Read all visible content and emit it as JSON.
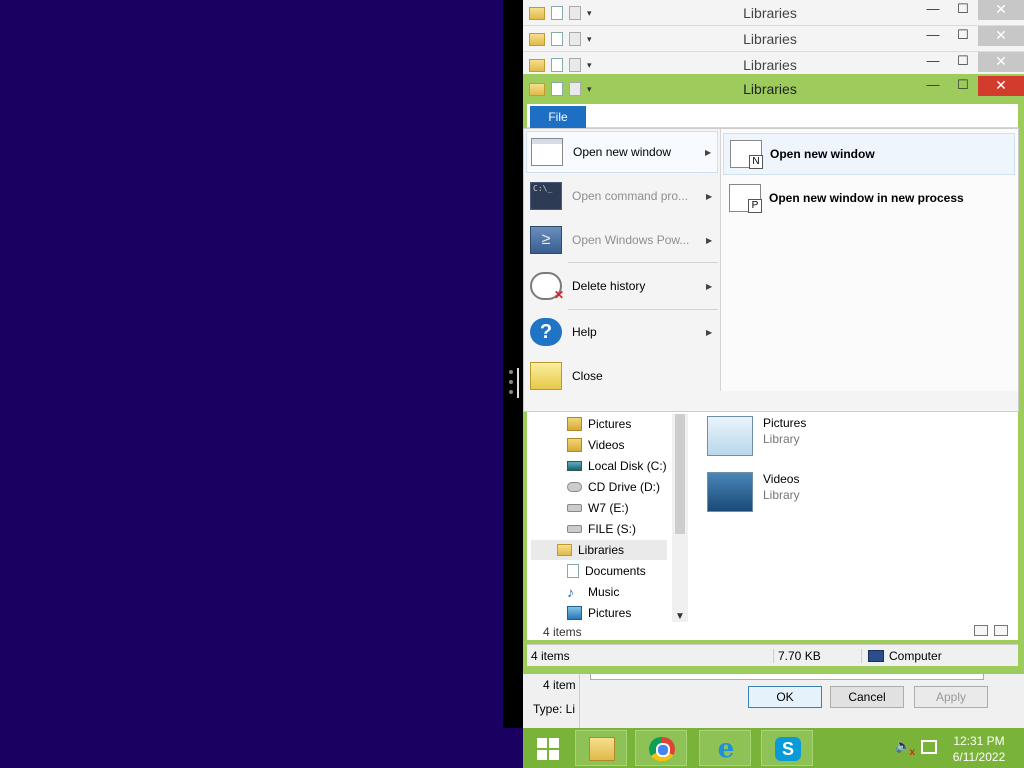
{
  "back_windows": [
    {
      "title": "Libraries",
      "min": "—",
      "max": "☐",
      "close": "✕"
    },
    {
      "title": "Libraries",
      "min": "—",
      "max": "☐",
      "close": "✕"
    },
    {
      "title": "Libraries",
      "min": "—",
      "max": "☐",
      "close": "✕"
    }
  ],
  "window": {
    "title": "Libraries",
    "min": "—",
    "max": "☐",
    "close": "✕"
  },
  "ribbon": {
    "file_tab": "File"
  },
  "file_menu": {
    "items": [
      {
        "label": "Open new window",
        "enabled": true,
        "has_submenu": true
      },
      {
        "label": "Open command pro...",
        "enabled": false,
        "has_submenu": true
      },
      {
        "label": "Open Windows Pow...",
        "enabled": false,
        "has_submenu": true
      },
      {
        "label": "Delete history",
        "enabled": true,
        "has_submenu": true
      },
      {
        "label": "Help",
        "enabled": true,
        "has_submenu": true
      },
      {
        "label": "Close",
        "enabled": true,
        "has_submenu": false
      }
    ],
    "submenu": [
      {
        "label": "Open new window",
        "badge": "N"
      },
      {
        "label": "Open new window in new process",
        "badge": "P"
      }
    ],
    "arrow": "▶",
    "cmd_glyph": "C:\\_",
    "ps_glyph": "≥",
    "help_glyph": "?"
  },
  "nav_tree": [
    {
      "label": "Pictures",
      "icon": "pictures-folder-icon"
    },
    {
      "label": "Videos",
      "icon": "videos-folder-icon"
    },
    {
      "label": "Local Disk (C:)",
      "icon": "local-disk-icon"
    },
    {
      "label": "CD Drive (D:)",
      "icon": "cd-drive-icon"
    },
    {
      "label": "W7 (E:)",
      "icon": "drive-icon"
    },
    {
      "label": "FILE (S:)",
      "icon": "drive-icon"
    },
    {
      "label": "Libraries",
      "icon": "libraries-icon"
    },
    {
      "label": "Documents",
      "icon": "documents-icon"
    },
    {
      "label": "Music",
      "icon": "music-icon"
    },
    {
      "label": "Pictures",
      "icon": "pictures-library-icon"
    }
  ],
  "music_glyph": "♪",
  "scroll_down": "▼",
  "libraries": [
    {
      "name": "Pictures",
      "type": "Library"
    },
    {
      "name": "Videos",
      "type": "Library"
    }
  ],
  "content_count": "4 items",
  "status": {
    "items": "4 items",
    "size": "7.70 KB",
    "location": "Computer"
  },
  "dialog": {
    "left_text_1": "4 item",
    "left_text_2": "Type: Li",
    "ok": "OK",
    "cancel": "Cancel",
    "apply": "Apply"
  },
  "clock": {
    "time": "12:31 PM",
    "date": "6/11/2022"
  },
  "taskbar": {
    "ie_glyph": "e",
    "skype_glyph": "S",
    "volume_glyph": "🔈"
  }
}
